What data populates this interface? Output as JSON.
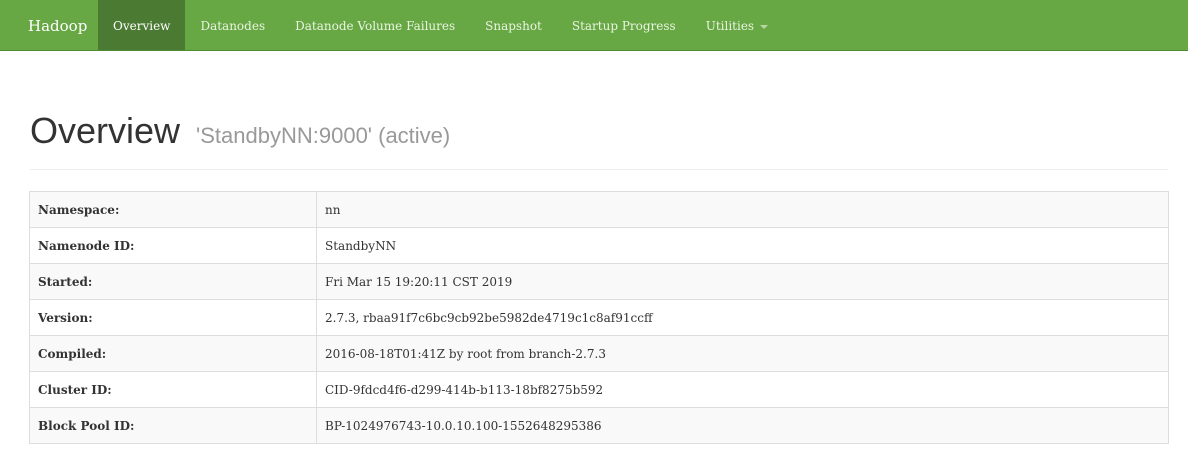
{
  "navbar": {
    "brand": "Hadoop",
    "items": [
      {
        "label": "Overview",
        "active": true
      },
      {
        "label": "Datanodes"
      },
      {
        "label": "Datanode Volume Failures"
      },
      {
        "label": "Snapshot"
      },
      {
        "label": "Startup Progress"
      },
      {
        "label": "Utilities",
        "dropdown": true
      }
    ]
  },
  "header": {
    "title": "Overview",
    "subtitle": "'StandbyNN:9000' (active)"
  },
  "overview": {
    "rows": [
      {
        "key": "Namespace:",
        "value": "nn"
      },
      {
        "key": "Namenode ID:",
        "value": "StandbyNN"
      },
      {
        "key": "Started:",
        "value": "Fri Mar 15 19:20:11 CST 2019"
      },
      {
        "key": "Version:",
        "value": "2.7.3, rbaa91f7c6bc9cb92be5982de4719c1c8af91ccff"
      },
      {
        "key": "Compiled:",
        "value": "2016-08-18T01:41Z by root from branch-2.7.3"
      },
      {
        "key": "Cluster ID:",
        "value": "CID-9fdcd4f6-d299-414b-b113-18bf8275b592"
      },
      {
        "key": "Block Pool ID:",
        "value": "BP-1024976743-10.0.10.100-1552648295386"
      }
    ]
  },
  "colors": {
    "navbar_bg": "#67a744",
    "navbar_active_bg": "#4b7a32"
  }
}
